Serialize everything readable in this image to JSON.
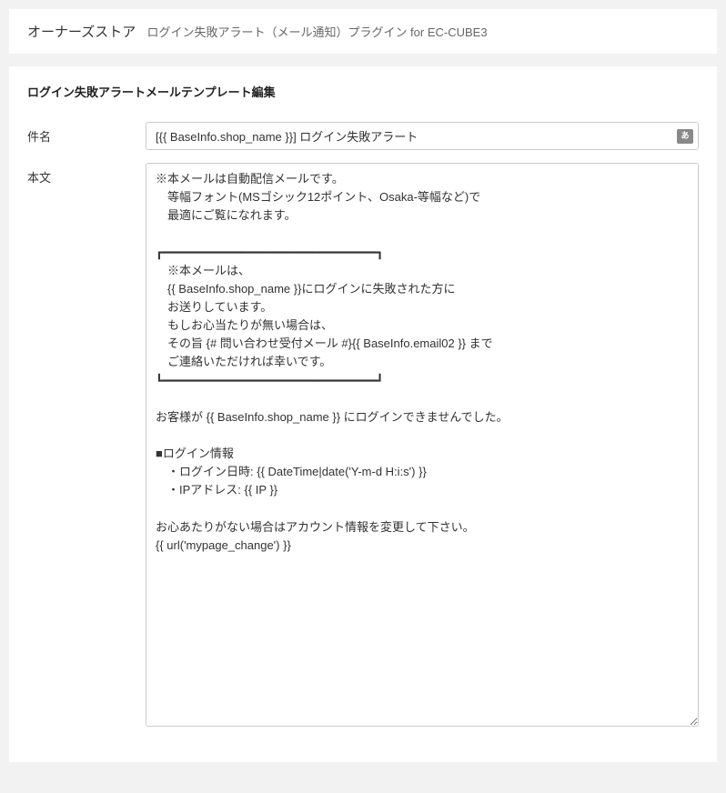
{
  "header": {
    "main": "オーナーズストア",
    "sub": "ログイン失敗アラート（メール通知）プラグイン for EC-CUBE3"
  },
  "panel": {
    "title": "ログイン失敗アラートメールテンプレート編集"
  },
  "form": {
    "subject_label": "件名",
    "subject_value": "[{{ BaseInfo.shop_name }}] ログイン失敗アラート",
    "body_label": "本文",
    "body_value": "※本メールは自動配信メールです。\n　等幅フォント(MSゴシック12ポイント、Osaka-等幅など)で\n　最適にご覧になれます。\n\n┏━━━━━━━━━━━━━━━━━━━━━━━━━━━━━━┓\n　※本メールは、\n　{{ BaseInfo.shop_name }}にログインに失敗された方に\n　お送りしています。\n　もしお心当たりが無い場合は、\n　その旨 {# 問い合わせ受付メール #}{{ BaseInfo.email02 }} まで\n　ご連絡いただければ幸いです。\n┗━━━━━━━━━━━━━━━━━━━━━━━━━━━━━━┛\n\nお客様が {{ BaseInfo.shop_name }} にログインできませんでした。\n\n■ログイン情報\n　・ログイン日時: {{ DateTime|date('Y-m-d H:i:s') }}\n　・IPアドレス: {{ IP }}\n\nお心あたりがない場合はアカウント情報を変更して下さい。\n{{ url('mypage_change') }}"
  },
  "icons": {
    "ime": "あ"
  }
}
